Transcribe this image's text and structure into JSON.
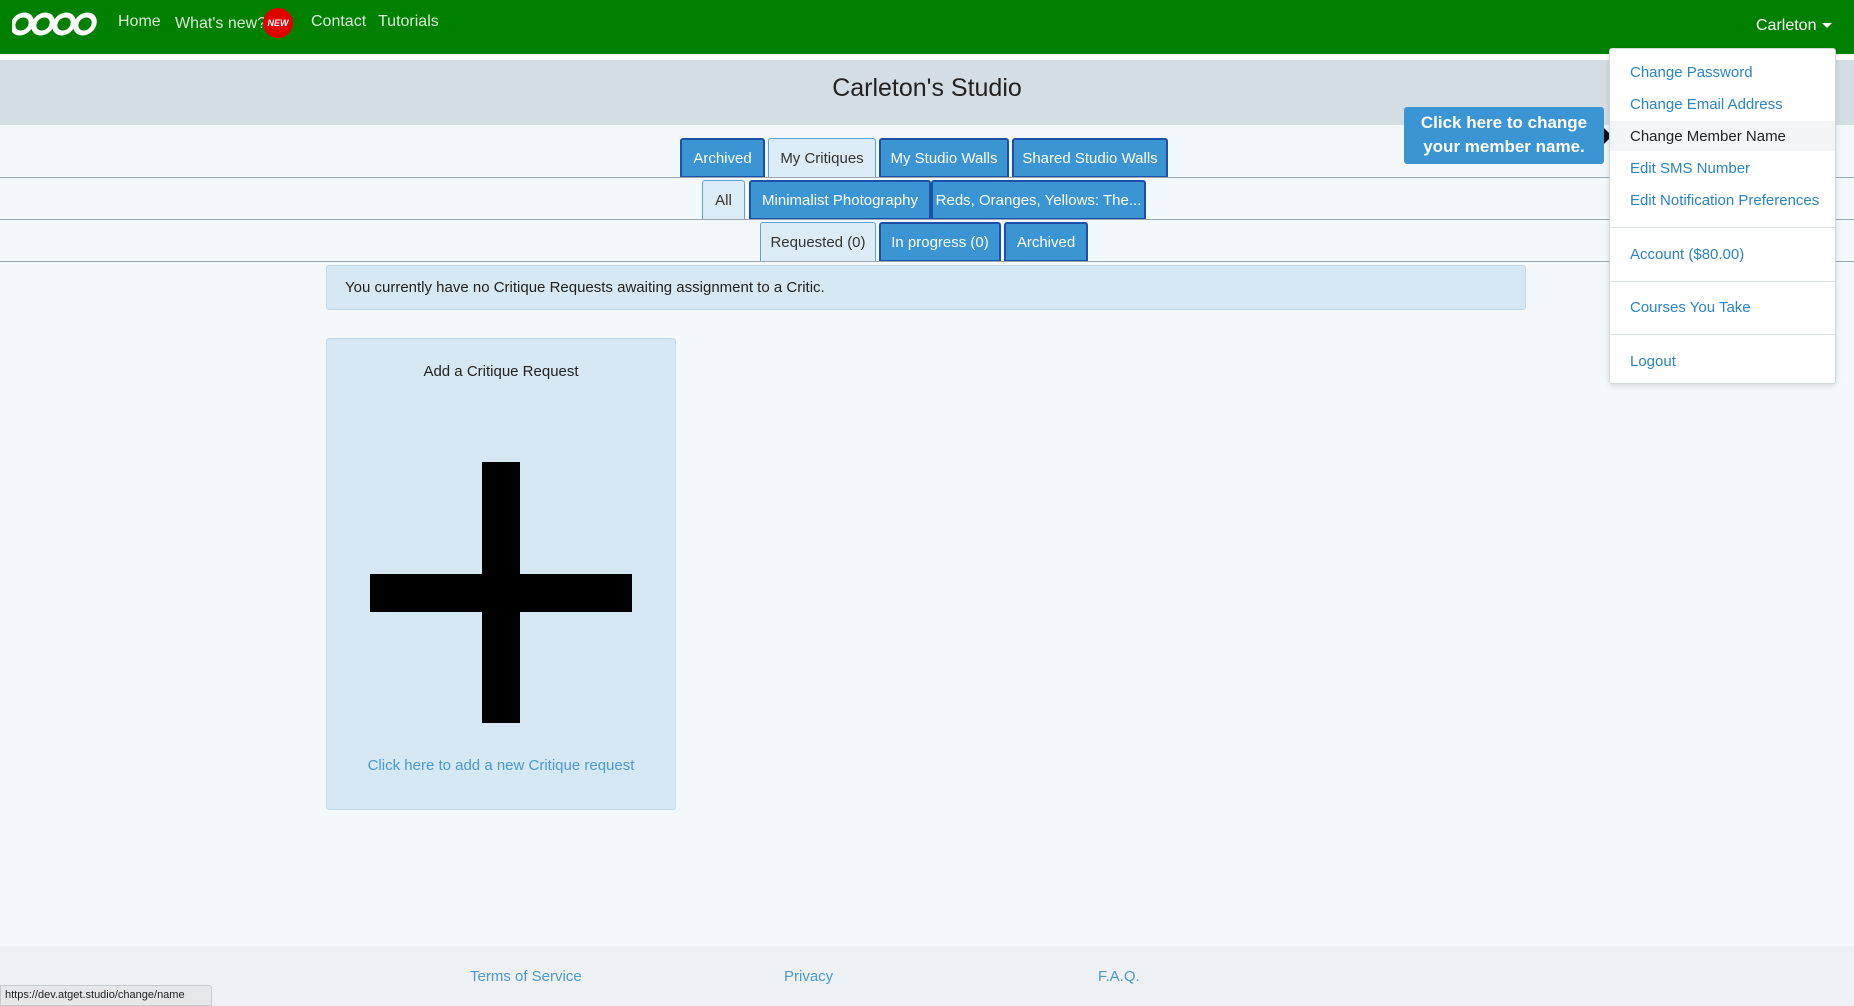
{
  "nav": {
    "logo_icon": "rings-logo-icon",
    "links": [
      "Home",
      "What's new?",
      "Contact",
      "Tutorials"
    ],
    "new_badge": "NEW",
    "user": "Carleton"
  },
  "studio": {
    "title": "Carleton's Studio"
  },
  "tabs_primary": [
    "Archived",
    "My Critiques",
    "My Studio Walls",
    "Shared Studio Walls"
  ],
  "tabs_secondary": [
    "All",
    "Minimalist Photography",
    "Reds, Oranges, Yellows: The..."
  ],
  "tabs_tertiary": [
    "Requested (0)",
    "In progress (0)",
    "Archived"
  ],
  "alert": {
    "text": "You currently have no Critique Requests awaiting assignment to a Critic."
  },
  "add_card": {
    "title": "Add a Critique Request",
    "icon": "plus-icon",
    "link": "Click here to add a new Critique request"
  },
  "dropdown": {
    "items": [
      "Change Password",
      "Change Email Address",
      "Change Member Name",
      "Edit SMS Number",
      "Edit Notification Preferences",
      "Account ($80.00)",
      "Courses You Take",
      "Logout"
    ]
  },
  "tooltip": {
    "text": "Click here to change your member name."
  },
  "footer": {
    "links": [
      "Terms of Service",
      "Privacy",
      "F.A.Q."
    ]
  },
  "status_url": "https://dev.atget.studio/change/name",
  "colors": {
    "navbar": "#008000",
    "tab_blue": "#3a95d2",
    "tab_border": "#1b4fa8",
    "link": "#2b83c5",
    "badge": "#e00000"
  }
}
